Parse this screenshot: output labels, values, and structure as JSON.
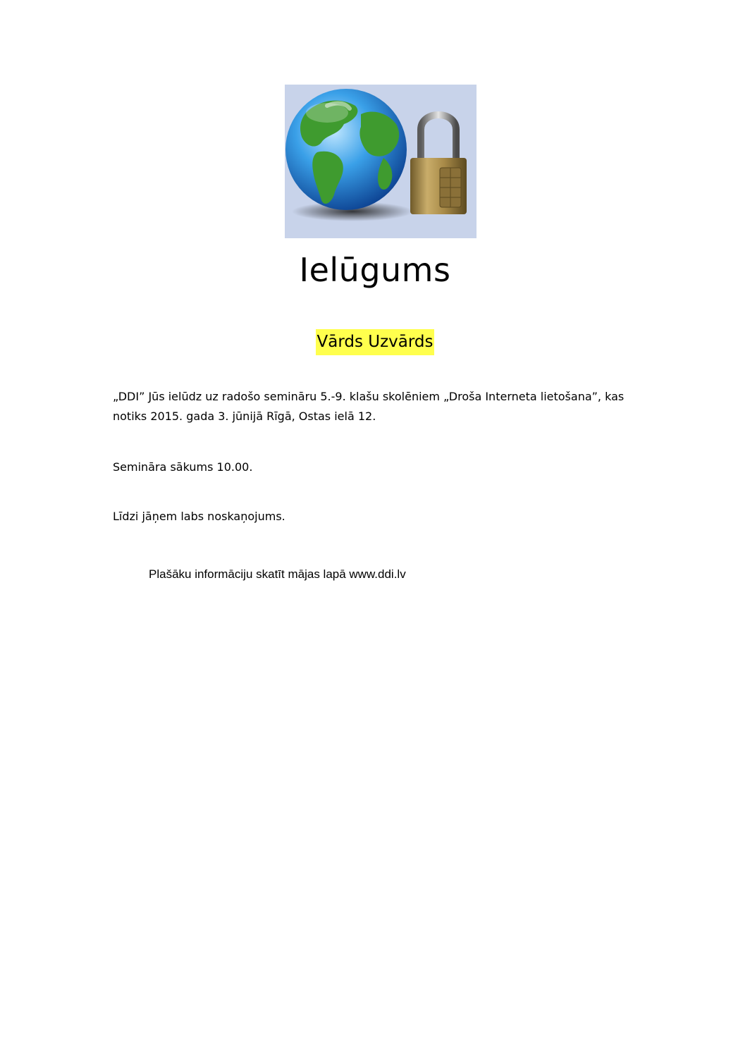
{
  "document": {
    "logo": {
      "name": "globe-and-padlock-image",
      "background": "#c8d3ea"
    },
    "title": "Ielūgums",
    "recipient_name": "Vārds Uzvārds",
    "highlight_color": "#ffff4d",
    "paragraphs": {
      "invitation": "„DDI” Jūs ielūdz uz radošo semināru 5.-9. klašu skolēniem „Droša Interneta lietošana”, kas notiks 2015. gada 3. jūnijā Rīgā, Ostas ielā 12.",
      "start_time": "Semināra sākums 10.00.",
      "bring_along": "Līdzi jāņem labs noskaņojums."
    },
    "info_line": "Plašāku informāciju skatīt mājas lapā www.ddi.lv"
  }
}
